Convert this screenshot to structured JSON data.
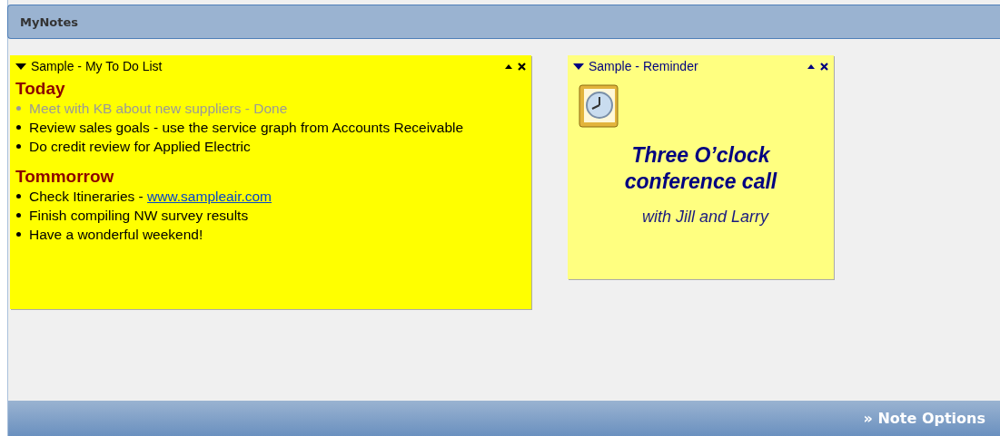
{
  "panel": {
    "title": "MyNotes"
  },
  "notes": [
    {
      "kind": "todo",
      "title": "Sample - My To Do List",
      "color": "#ffff00",
      "sections": [
        {
          "heading": "Today",
          "items": [
            {
              "text": "Meet with KB about new suppliers - Done",
              "done": true
            },
            {
              "text": "Review sales goals - use the service graph from Accounts Receivable",
              "done": false
            },
            {
              "text": "Do credit review for Applied Electric",
              "done": false
            }
          ]
        },
        {
          "heading": "Tommorrow",
          "items": [
            {
              "text": "Check Itineraries -",
              "link": "www.sampleair.com",
              "done": false
            },
            {
              "text": "Finish compiling NW survey results",
              "done": false
            },
            {
              "text": "Have a wonderful weekend!",
              "done": false
            }
          ]
        }
      ]
    },
    {
      "kind": "reminder",
      "title": "Sample - Reminder",
      "color": "#ffff80",
      "headline": "Three O’clock conference call",
      "detail": "with Jill and Larry"
    }
  ],
  "footer": {
    "link": "» Note Options"
  }
}
